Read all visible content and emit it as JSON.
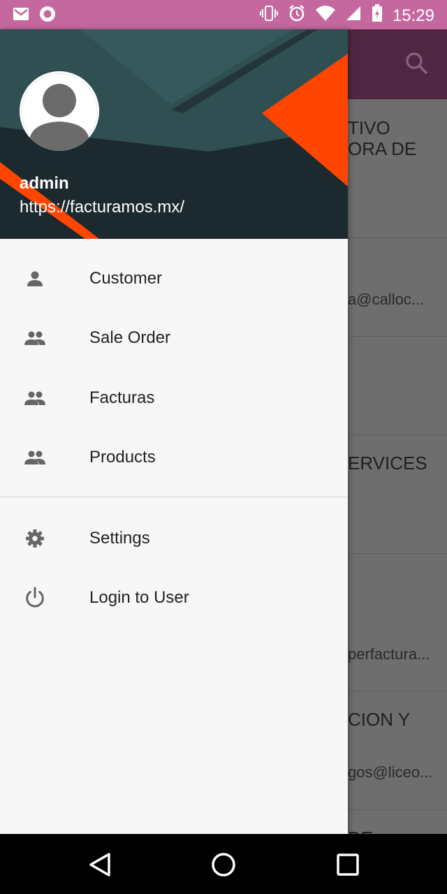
{
  "status_bar": {
    "time": "15:29"
  },
  "app_bar": {
    "search_icon": "search-icon"
  },
  "background_list": {
    "rows": [
      {
        "line1": "TIVO",
        "line2": "ORA DE",
        "line3": ""
      },
      {
        "line1": "",
        "line2": "a@calloc...",
        "line3": ""
      },
      {
        "line1": "",
        "line2": "",
        "line3": ""
      },
      {
        "line1": "ERVICES",
        "line2": "",
        "line3": ""
      },
      {
        "line1": "",
        "line2": "perfactura...",
        "line3": ""
      },
      {
        "line1": "CION Y",
        "line2": "gos@liceo...",
        "line3": ""
      },
      {
        "line1": "DE",
        "line2": "",
        "line3": ""
      }
    ]
  },
  "drawer": {
    "header": {
      "user_name": "admin",
      "user_url": "https://facturamos.mx/"
    },
    "menu": [
      {
        "label": "Customer",
        "icon": "person-icon"
      },
      {
        "label": "Sale Order",
        "icon": "group-icon"
      },
      {
        "label": "Facturas",
        "icon": "group-icon"
      },
      {
        "label": "Products",
        "icon": "group-icon"
      },
      {
        "label": "Settings",
        "icon": "gear-icon"
      },
      {
        "label": "Login to User",
        "icon": "power-icon"
      }
    ]
  },
  "colors": {
    "status_bar": "#c5689f",
    "app_bar": "#4f2742",
    "header_dark": "#1c2a2f",
    "header_teal": "#2f4f52",
    "accent_orange": "#ff4500",
    "drawer_bg": "#f7f7f7"
  }
}
